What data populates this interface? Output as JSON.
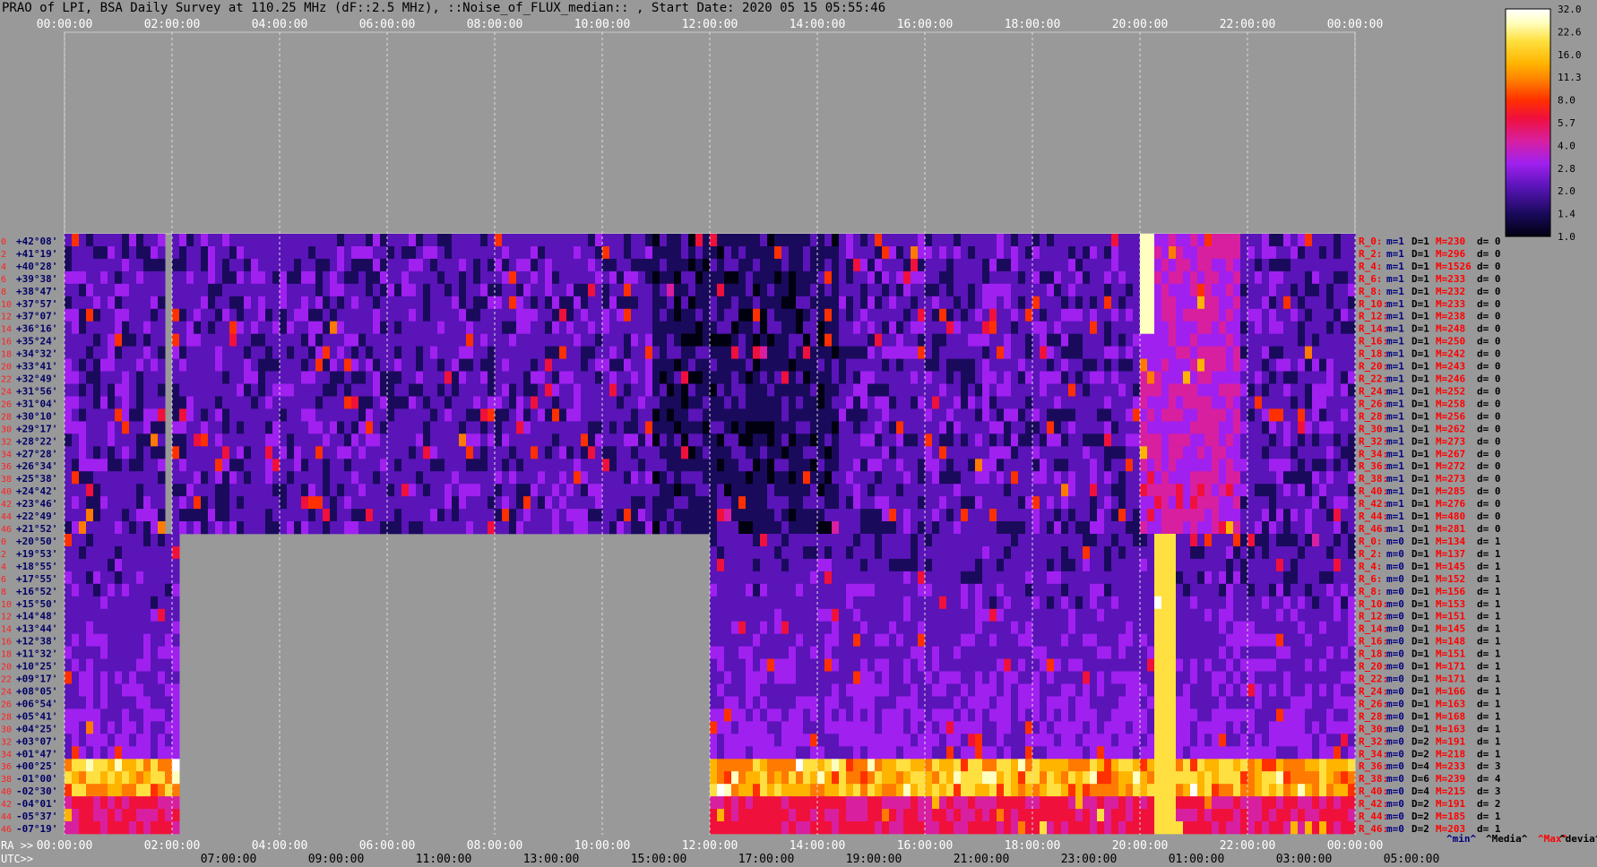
{
  "title": "PRAO of LPI, BSA Daily Survey at 110.25 MHz (dF::2.5 MHz), ::Noise_of_FLUX_median:: , Start Date: 2020 05 15 05:55:46",
  "chart_data": {
    "type": "heatmap",
    "title": "PRAO of LPI, BSA Daily Survey at 110.25 MHz (dF::2.5 MHz), ::Noise_of_FLUX_median:: , Start Date: 2020 05 15 05:55:46",
    "x_top_ticks": [
      "00:00:00",
      "02:00:00",
      "04:00:00",
      "06:00:00",
      "08:00:00",
      "10:00:00",
      "12:00:00",
      "14:00:00",
      "16:00:00",
      "18:00:00",
      "20:00:00",
      "22:00:00",
      "00:00:00"
    ],
    "ra_label": "RA >>",
    "ra_ticks": [
      "00:00:00",
      "02:00:00",
      "04:00:00",
      "06:00:00",
      "08:00:00",
      "10:00:00",
      "12:00:00",
      "14:00:00",
      "16:00:00",
      "18:00:00",
      "20:00:00",
      "22:00:00",
      "00:00:00"
    ],
    "utc_label": "UTC>>",
    "utc_ticks": [
      "07:00:00",
      "09:00:00",
      "11:00:00",
      "13:00:00",
      "15:00:00",
      "17:00:00",
      "19:00:00",
      "21:00:00",
      "23:00:00",
      "01:00:00",
      "03:00:00",
      "05:00:00"
    ],
    "colorbar": {
      "ticks": [
        "32.0",
        "22.6",
        "16.0",
        "11.3",
        "8.0",
        "5.7",
        "4.0",
        "2.8",
        "2.0",
        "1.4",
        "1.0"
      ],
      "range": [
        1.0,
        32.0
      ],
      "colors": [
        "#000010",
        "#1a0a5c",
        "#5a14b8",
        "#a020f0",
        "#d81fa0",
        "#f0103c",
        "#ff3000",
        "#ff7a00",
        "#ffb400",
        "#ffe040",
        "#ffffc0",
        "#ffffff"
      ]
    },
    "bottom_legend": [
      {
        "text": "^min^",
        "color": "#000080"
      },
      {
        "text": "^Media^",
        "color": "#000000"
      },
      {
        "text": "^Max^",
        "color": "#ff0000"
      },
      {
        "text": "^devia^",
        "color": "#000000"
      }
    ],
    "upper_block": {
      "dec_labels": [
        "+42°08'",
        "+41°19'",
        "+40°28'",
        "+39°38'",
        "+38°47'",
        "+37°57'",
        "+37°07'",
        "+36°16'",
        "+35°24'",
        "+34°32'",
        "+33°41'",
        "+32°49'",
        "+31°56'",
        "+31°04'",
        "+30°10'",
        "+29°17'",
        "+28°22'",
        "+27°28'",
        "+26°34'",
        "+25°38'",
        "+24°42'",
        "+23°46'",
        "+22°49'",
        "+21°52'"
      ],
      "row_stats": [
        {
          "r": "R_0:",
          "m": "m=1",
          "D": "D=1",
          "M": "M=230",
          "d": "d= 0"
        },
        {
          "r": "R_2:",
          "m": "m=1",
          "D": "D=1",
          "M": "M=296",
          "d": "d= 0"
        },
        {
          "r": "R_4:",
          "m": "m=1",
          "D": "D=1",
          "M": "M=1526",
          "d": "d= 0"
        },
        {
          "r": "R_6:",
          "m": "m=1",
          "D": "D=1",
          "M": "M=233",
          "d": "d= 0"
        },
        {
          "r": "R_8:",
          "m": "m=1",
          "D": "D=1",
          "M": "M=232",
          "d": "d= 0"
        },
        {
          "r": "R_10:",
          "m": "m=1",
          "D": "D=1",
          "M": "M=233",
          "d": "d= 0"
        },
        {
          "r": "R_12:",
          "m": "m=1",
          "D": "D=1",
          "M": "M=238",
          "d": "d= 0"
        },
        {
          "r": "R_14:",
          "m": "m=1",
          "D": "D=1",
          "M": "M=248",
          "d": "d= 0"
        },
        {
          "r": "R_16:",
          "m": "m=1",
          "D": "D=1",
          "M": "M=250",
          "d": "d= 0"
        },
        {
          "r": "R_18:",
          "m": "m=1",
          "D": "D=1",
          "M": "M=242",
          "d": "d= 0"
        },
        {
          "r": "R_20:",
          "m": "m=1",
          "D": "D=1",
          "M": "M=243",
          "d": "d= 0"
        },
        {
          "r": "R_22:",
          "m": "m=1",
          "D": "D=1",
          "M": "M=246",
          "d": "d= 0"
        },
        {
          "r": "R_24:",
          "m": "m=1",
          "D": "D=1",
          "M": "M=252",
          "d": "d= 0"
        },
        {
          "r": "R_26:",
          "m": "m=1",
          "D": "D=1",
          "M": "M=258",
          "d": "d= 0"
        },
        {
          "r": "R_28:",
          "m": "m=1",
          "D": "D=1",
          "M": "M=256",
          "d": "d= 0"
        },
        {
          "r": "R_30:",
          "m": "m=1",
          "D": "D=1",
          "M": "M=262",
          "d": "d= 0"
        },
        {
          "r": "R_32:",
          "m": "m=1",
          "D": "D=1",
          "M": "M=273",
          "d": "d= 0"
        },
        {
          "r": "R_34:",
          "m": "m=1",
          "D": "D=1",
          "M": "M=267",
          "d": "d= 0"
        },
        {
          "r": "R_36:",
          "m": "m=1",
          "D": "D=1",
          "M": "M=272",
          "d": "d= 0"
        },
        {
          "r": "R_38:",
          "m": "m=1",
          "D": "D=1",
          "M": "M=273",
          "d": "d= 0"
        },
        {
          "r": "R_40:",
          "m": "m=1",
          "D": "D=1",
          "M": "M=285",
          "d": "d= 0"
        },
        {
          "r": "R_42:",
          "m": "m=1",
          "D": "D=1",
          "M": "M=276",
          "d": "d= 0"
        },
        {
          "r": "R_44:",
          "m": "m=1",
          "D": "D=1",
          "M": "M=480",
          "d": "d= 0"
        },
        {
          "r": "R_46:",
          "m": "m=1",
          "D": "D=1",
          "M": "M=281",
          "d": "d= 0"
        }
      ]
    },
    "lower_block": {
      "dec_labels": [
        "+20°50'",
        "+19°53'",
        "+18°55'",
        "+17°55'",
        "+16°52'",
        "+15°50'",
        "+14°48'",
        "+13°44'",
        "+12°38'",
        "+11°32'",
        "+10°25'",
        "+09°17'",
        "+08°05'",
        "+06°54'",
        "+05°41'",
        "+04°25'",
        "+03°07'",
        "+01°47'",
        "+00°25'",
        "-01°00'",
        "-02°30'",
        "-04°01'",
        "-05°37'",
        "-07°19'"
      ],
      "row_stats": [
        {
          "r": "R_0:",
          "m": "m=0",
          "D": "D=1",
          "M": "M=134",
          "d": "d= 1"
        },
        {
          "r": "R_2:",
          "m": "m=0",
          "D": "D=1",
          "M": "M=137",
          "d": "d= 1"
        },
        {
          "r": "R_4:",
          "m": "m=0",
          "D": "D=1",
          "M": "M=145",
          "d": "d= 1"
        },
        {
          "r": "R_6:",
          "m": "m=0",
          "D": "D=1",
          "M": "M=152",
          "d": "d= 1"
        },
        {
          "r": "R_8:",
          "m": "m=0",
          "D": "D=1",
          "M": "M=156",
          "d": "d= 1"
        },
        {
          "r": "R_10:",
          "m": "m=0",
          "D": "D=1",
          "M": "M=153",
          "d": "d= 1"
        },
        {
          "r": "R_12:",
          "m": "m=0",
          "D": "D=1",
          "M": "M=151",
          "d": "d= 1"
        },
        {
          "r": "R_14:",
          "m": "m=0",
          "D": "D=1",
          "M": "M=145",
          "d": "d= 1"
        },
        {
          "r": "R_16:",
          "m": "m=0",
          "D": "D=1",
          "M": "M=148",
          "d": "d= 1"
        },
        {
          "r": "R_18:",
          "m": "m=0",
          "D": "D=1",
          "M": "M=151",
          "d": "d= 1"
        },
        {
          "r": "R_20:",
          "m": "m=0",
          "D": "D=1",
          "M": "M=171",
          "d": "d= 1"
        },
        {
          "r": "R_22:",
          "m": "m=0",
          "D": "D=1",
          "M": "M=171",
          "d": "d= 1"
        },
        {
          "r": "R_24:",
          "m": "m=0",
          "D": "D=1",
          "M": "M=166",
          "d": "d= 1"
        },
        {
          "r": "R_26:",
          "m": "m=0",
          "D": "D=1",
          "M": "M=163",
          "d": "d= 1"
        },
        {
          "r": "R_28:",
          "m": "m=0",
          "D": "D=1",
          "M": "M=168",
          "d": "d= 1"
        },
        {
          "r": "R_30:",
          "m": "m=0",
          "D": "D=1",
          "M": "M=163",
          "d": "d= 1"
        },
        {
          "r": "R_32:",
          "m": "m=0",
          "D": "D=2",
          "M": "M=191",
          "d": "d= 1"
        },
        {
          "r": "R_34:",
          "m": "m=0",
          "D": "D=2",
          "M": "M=218",
          "d": "d= 1"
        },
        {
          "r": "R_36:",
          "m": "m=0",
          "D": "D=4",
          "M": "M=233",
          "d": "d= 3"
        },
        {
          "r": "R_38:",
          "m": "m=0",
          "D": "D=6",
          "M": "M=239",
          "d": "d= 4"
        },
        {
          "r": "R_40:",
          "m": "m=0",
          "D": "D=4",
          "M": "M=215",
          "d": "d= 3"
        },
        {
          "r": "R_42:",
          "m": "m=0",
          "D": "D=2",
          "M": "M=191",
          "d": "d= 2"
        },
        {
          "r": "R_44:",
          "m": "m=0",
          "D": "D=2",
          "M": "M=185",
          "d": "d= 1"
        },
        {
          "r": "R_46:",
          "m": "m=0",
          "D": "D=2",
          "M": "M=203",
          "d": "d= 1"
        }
      ]
    }
  }
}
